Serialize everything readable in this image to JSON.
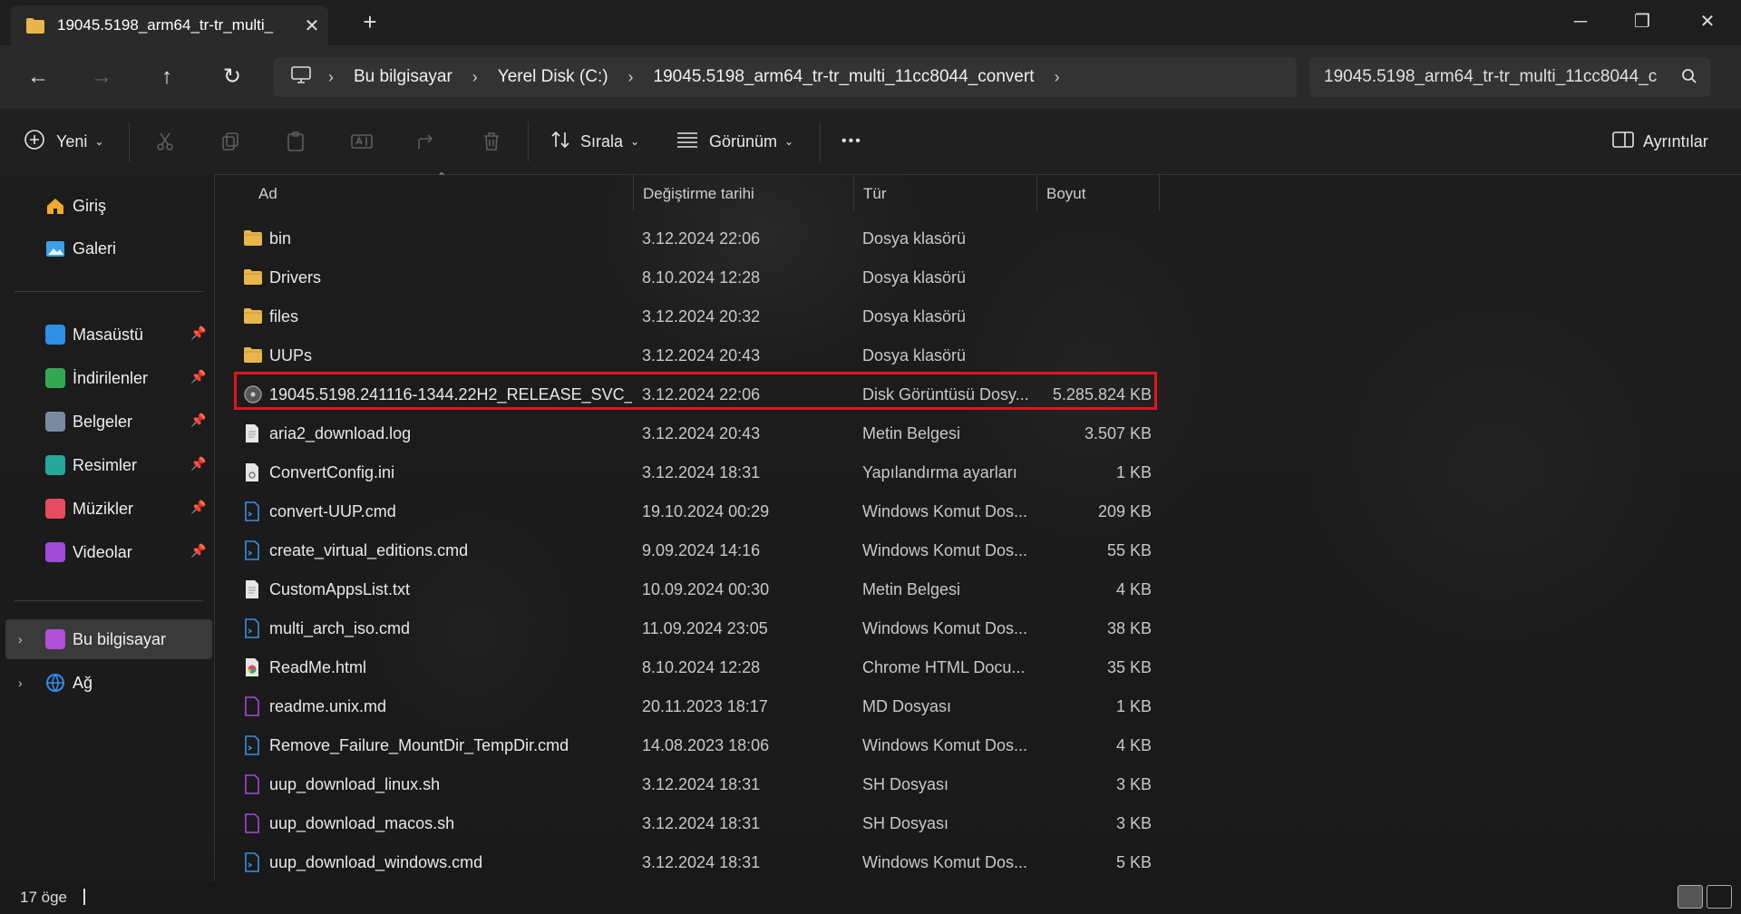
{
  "window": {
    "tab_title": "19045.5198_arm64_tr-tr_multi_",
    "minimize_glyph": "─",
    "restore_glyph": "❐",
    "close_glyph": "✕"
  },
  "address": {
    "crumbs": [
      "Bu bilgisayar",
      "Yerel Disk (C:)",
      "19045.5198_arm64_tr-tr_multi_11cc8044_convert"
    ],
    "search_text": "19045.5198_arm64_tr-tr_multi_11cc8044_c"
  },
  "toolbar": {
    "new_label": "Yeni",
    "sort_label": "Sırala",
    "view_label": "Görünüm",
    "more_label": "•••",
    "details_label": "Ayrıntılar"
  },
  "sidebar": {
    "top": [
      {
        "label": "Giriş",
        "icon": "home-icon",
        "color": "#f0a830"
      },
      {
        "label": "Galeri",
        "icon": "gallery-icon",
        "color": "#3aa0e8"
      }
    ],
    "pinned": [
      {
        "label": "Masaüstü",
        "icon": "desktop-icon",
        "color": "#2f8ee6"
      },
      {
        "label": "İndirilenler",
        "icon": "downloads-icon",
        "color": "#33a852"
      },
      {
        "label": "Belgeler",
        "icon": "documents-icon",
        "color": "#7a8aa0"
      },
      {
        "label": "Resimler",
        "icon": "pictures-icon",
        "color": "#25a79a"
      },
      {
        "label": "Müzikler",
        "icon": "music-icon",
        "color": "#e84a5f"
      },
      {
        "label": "Videolar",
        "icon": "videos-icon",
        "color": "#a24ad8"
      }
    ],
    "bottom": [
      {
        "label": "Bu bilgisayar",
        "icon": "this-pc-icon",
        "color": "#b04fd8"
      },
      {
        "label": "Ağ",
        "icon": "network-icon",
        "color": "#2f8ee6"
      }
    ]
  },
  "columns": {
    "name": "Ad",
    "modified": "Değiştirme tarihi",
    "type": "Tür",
    "size": "Boyut"
  },
  "files": [
    {
      "name": "bin",
      "date": "3.12.2024 22:06",
      "type": "Dosya klasörü",
      "size": "",
      "icon": "folder-icon"
    },
    {
      "name": "Drivers",
      "date": "8.10.2024 12:28",
      "type": "Dosya klasörü",
      "size": "",
      "icon": "folder-icon"
    },
    {
      "name": "files",
      "date": "3.12.2024 20:32",
      "type": "Dosya klasörü",
      "size": "",
      "icon": "folder-icon"
    },
    {
      "name": "UUPs",
      "date": "3.12.2024 20:43",
      "type": "Dosya klasörü",
      "size": "",
      "icon": "folder-icon"
    },
    {
      "name": "19045.5198.241116-1344.22H2_RELEASE_SVC_...",
      "date": "3.12.2024 22:06",
      "type": "Disk Görüntüsü Dosy...",
      "size": "5.285.824 KB",
      "icon": "disc-image-icon"
    },
    {
      "name": "aria2_download.log",
      "date": "3.12.2024 20:43",
      "type": "Metin Belgesi",
      "size": "3.507 KB",
      "icon": "text-file-icon"
    },
    {
      "name": "ConvertConfig.ini",
      "date": "3.12.2024 18:31",
      "type": "Yapılandırma ayarları",
      "size": "1 KB",
      "icon": "config-file-icon"
    },
    {
      "name": "convert-UUP.cmd",
      "date": "19.10.2024 00:29",
      "type": "Windows Komut Dos...",
      "size": "209 KB",
      "icon": "cmd-file-icon"
    },
    {
      "name": "create_virtual_editions.cmd",
      "date": "9.09.2024 14:16",
      "type": "Windows Komut Dos...",
      "size": "55 KB",
      "icon": "cmd-file-icon"
    },
    {
      "name": "CustomAppsList.txt",
      "date": "10.09.2024 00:30",
      "type": "Metin Belgesi",
      "size": "4 KB",
      "icon": "text-file-icon"
    },
    {
      "name": "multi_arch_iso.cmd",
      "date": "11.09.2024 23:05",
      "type": "Windows Komut Dos...",
      "size": "38 KB",
      "icon": "cmd-file-icon"
    },
    {
      "name": "ReadMe.html",
      "date": "8.10.2024 12:28",
      "type": "Chrome HTML Docu...",
      "size": "35 KB",
      "icon": "chrome-html-icon"
    },
    {
      "name": "readme.unix.md",
      "date": "20.11.2023 18:17",
      "type": "MD Dosyası",
      "size": "1 KB",
      "icon": "md-file-icon"
    },
    {
      "name": "Remove_Failure_MountDir_TempDir.cmd",
      "date": "14.08.2023 18:06",
      "type": "Windows Komut Dos...",
      "size": "4 KB",
      "icon": "cmd-file-icon"
    },
    {
      "name": "uup_download_linux.sh",
      "date": "3.12.2024 18:31",
      "type": "SH Dosyası",
      "size": "3 KB",
      "icon": "sh-file-icon"
    },
    {
      "name": "uup_download_macos.sh",
      "date": "3.12.2024 18:31",
      "type": "SH Dosyası",
      "size": "3 KB",
      "icon": "sh-file-icon"
    },
    {
      "name": "uup_download_windows.cmd",
      "date": "3.12.2024 18:31",
      "type": "Windows Komut Dos...",
      "size": "5 KB",
      "icon": "cmd-file-icon"
    }
  ],
  "status": {
    "count": "17 öge"
  },
  "colors": {
    "highlight": "#e3141b",
    "folder": "#e8b64a",
    "cmd": "#3b8fe0",
    "sh": "#a24ad8"
  }
}
